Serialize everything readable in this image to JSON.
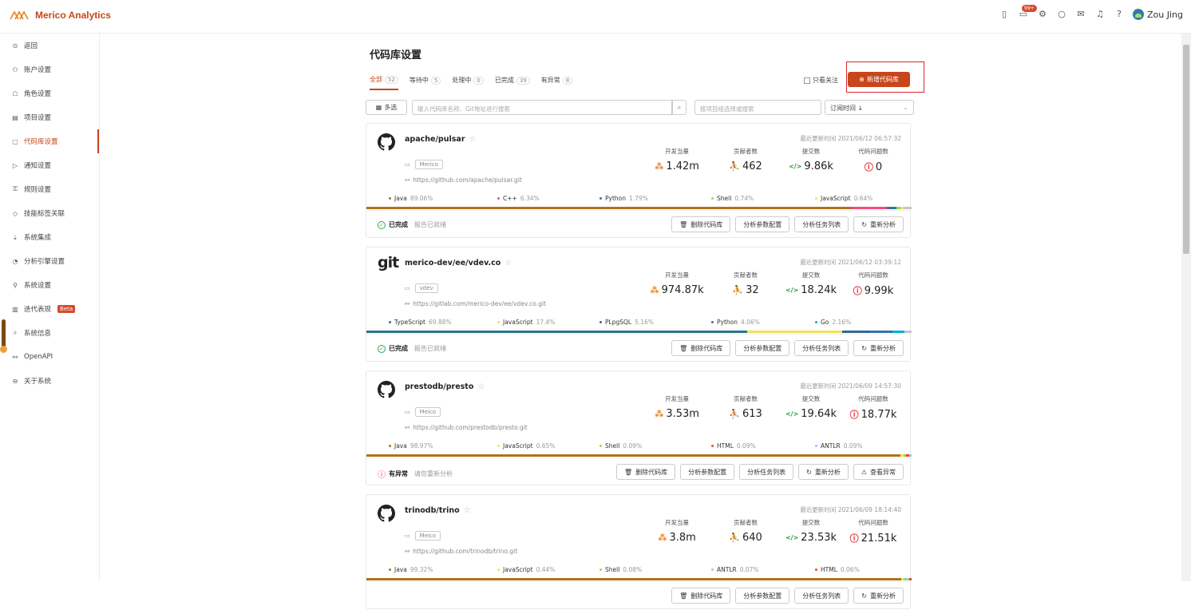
{
  "app": {
    "title": "Merico Analytics"
  },
  "header": {
    "user_name": "Zou Jing",
    "badge_count": "99+"
  },
  "sidebar": {
    "items": [
      {
        "label": "返回",
        "icon": "back-icon"
      },
      {
        "label": "账户设置",
        "icon": "account-icon"
      },
      {
        "label": "角色设置",
        "icon": "role-icon"
      },
      {
        "label": "项目设置",
        "icon": "project-icon"
      },
      {
        "label": "代码库设置",
        "icon": "repo-icon",
        "active": true
      },
      {
        "label": "通知设置",
        "icon": "notify-icon"
      },
      {
        "label": "规则设置",
        "icon": "rule-icon"
      },
      {
        "label": "技能标签关联",
        "icon": "tag-icon"
      },
      {
        "label": "系统集成",
        "icon": "integration-icon"
      },
      {
        "label": "分析引擎设置",
        "icon": "engine-icon"
      },
      {
        "label": "系统设置",
        "icon": "settings-icon"
      },
      {
        "label": "迭代表现",
        "icon": "iteration-icon",
        "badge": "Beta"
      },
      {
        "label": "系统信息",
        "icon": "info-icon"
      },
      {
        "label": "OpenAPI",
        "icon": "api-icon"
      },
      {
        "label": "关于系统",
        "icon": "about-icon"
      }
    ]
  },
  "page": {
    "title": "代码库设置",
    "follow_label": "只看关注",
    "add_label": "新增代码库"
  },
  "tabs": [
    {
      "label": "全部",
      "count": "52",
      "active": true
    },
    {
      "label": "等待中",
      "count": "5"
    },
    {
      "label": "处理中",
      "count": "0"
    },
    {
      "label": "已完成",
      "count": "39"
    },
    {
      "label": "有异常",
      "count": "8"
    }
  ],
  "filters": {
    "multi_label": "多选",
    "search_placeholder": "输入代码库名称、Git地址进行搜索",
    "project_placeholder": "按项目组选择或搜索",
    "sort_label": "订阅时间 ↓"
  },
  "metric_labels": {
    "dev_equiv": "开发当量",
    "contributors": "贡献者数",
    "commits": "提交数",
    "issues": "代码问题数"
  },
  "actions": {
    "delete": "删除代码库",
    "config": "分析参数配置",
    "tasks": "分析任务列表",
    "reanalyze": "重新分析",
    "view_error": "查看异常"
  },
  "repos": [
    {
      "name": "apache/pulsar",
      "logo": "github-icon",
      "tag": "Merico",
      "url": "https://github.com/apache/pulsar.git",
      "updated": "最近更新时间 2021/06/12 06:57:32",
      "dev_equiv": "1.42m",
      "contributors": "462",
      "commits": "9.86k",
      "issues": "0",
      "status": "已完成",
      "status_sub": "报告已就绪",
      "status_type": "done",
      "langs": [
        {
          "name": "Java",
          "pct": "89.06%",
          "color": "#b07219"
        },
        {
          "name": "C++",
          "pct": "6.34%",
          "color": "#f34b7d"
        },
        {
          "name": "Python",
          "pct": "1.79%",
          "color": "#3572a5"
        },
        {
          "name": "Shell",
          "pct": "0.74%",
          "color": "#89e051"
        },
        {
          "name": "JavaScript",
          "pct": "0.64%",
          "color": "#f1e05a"
        }
      ]
    },
    {
      "name": "merico-dev/ee/vdev.co",
      "logo": "git-icon",
      "tag": "vdev",
      "url": "https://gitlab.com/merico-dev/ee/vdev.co.git",
      "updated": "最近更新时间 2021/06/12 03:39:12",
      "dev_equiv": "974.87k",
      "contributors": "32",
      "commits": "18.24k",
      "issues": "9.99k",
      "status": "已完成",
      "status_sub": "报告已就绪",
      "status_type": "done",
      "langs": [
        {
          "name": "TypeScript",
          "pct": "69.88%",
          "color": "#2b7489"
        },
        {
          "name": "JavaScript",
          "pct": "17.4%",
          "color": "#f1e05a"
        },
        {
          "name": "PLpgSQL",
          "pct": "5.16%",
          "color": "#336790"
        },
        {
          "name": "Python",
          "pct": "4.06%",
          "color": "#3572a5"
        },
        {
          "name": "Go",
          "pct": "2.16%",
          "color": "#00add8"
        }
      ]
    },
    {
      "name": "prestodb/presto",
      "logo": "github-icon",
      "tag": "Meico",
      "url": "https://github.com/prestodb/presto.git",
      "updated": "最近更新时间 2021/06/09 14:57:30",
      "dev_equiv": "3.53m",
      "contributors": "613",
      "commits": "19.64k",
      "issues": "18.77k",
      "status": "有异常",
      "status_sub": "请您重新分析",
      "status_type": "error",
      "langs": [
        {
          "name": "Java",
          "pct": "98.97%",
          "color": "#b07219"
        },
        {
          "name": "JavaScript",
          "pct": "0.65%",
          "color": "#f1e05a"
        },
        {
          "name": "Shell",
          "pct": "0.09%",
          "color": "#89e051"
        },
        {
          "name": "HTML",
          "pct": "0.09%",
          "color": "#e34c26"
        },
        {
          "name": "ANTLR",
          "pct": "0.09%",
          "color": "#9dc3ff"
        }
      ]
    },
    {
      "name": "trinodb/trino",
      "logo": "github-icon",
      "tag": "Meico",
      "url": "https://github.com/trinodb/trino.git",
      "updated": "最近更新时间 2021/06/09 18:14:40",
      "dev_equiv": "3.8m",
      "contributors": "640",
      "commits": "23.53k",
      "issues": "21.51k",
      "status": "",
      "status_sub": "",
      "status_type": "none",
      "langs": [
        {
          "name": "Java",
          "pct": "99.32%",
          "color": "#b07219"
        },
        {
          "name": "JavaScript",
          "pct": "0.44%",
          "color": "#f1e05a"
        },
        {
          "name": "Shell",
          "pct": "0.08%",
          "color": "#89e051"
        },
        {
          "name": "ANTLR",
          "pct": "0.07%",
          "color": "#9dc3ff"
        },
        {
          "name": "HTML",
          "pct": "0.06%",
          "color": "#e34c26"
        }
      ]
    }
  ],
  "colors": {
    "accent": "#c8461c",
    "dev_icon": "#e8821e",
    "contrib_icon": "#17a2c8",
    "commit_icon": "#1f9a3c",
    "issue_icon": "#e0232d"
  }
}
